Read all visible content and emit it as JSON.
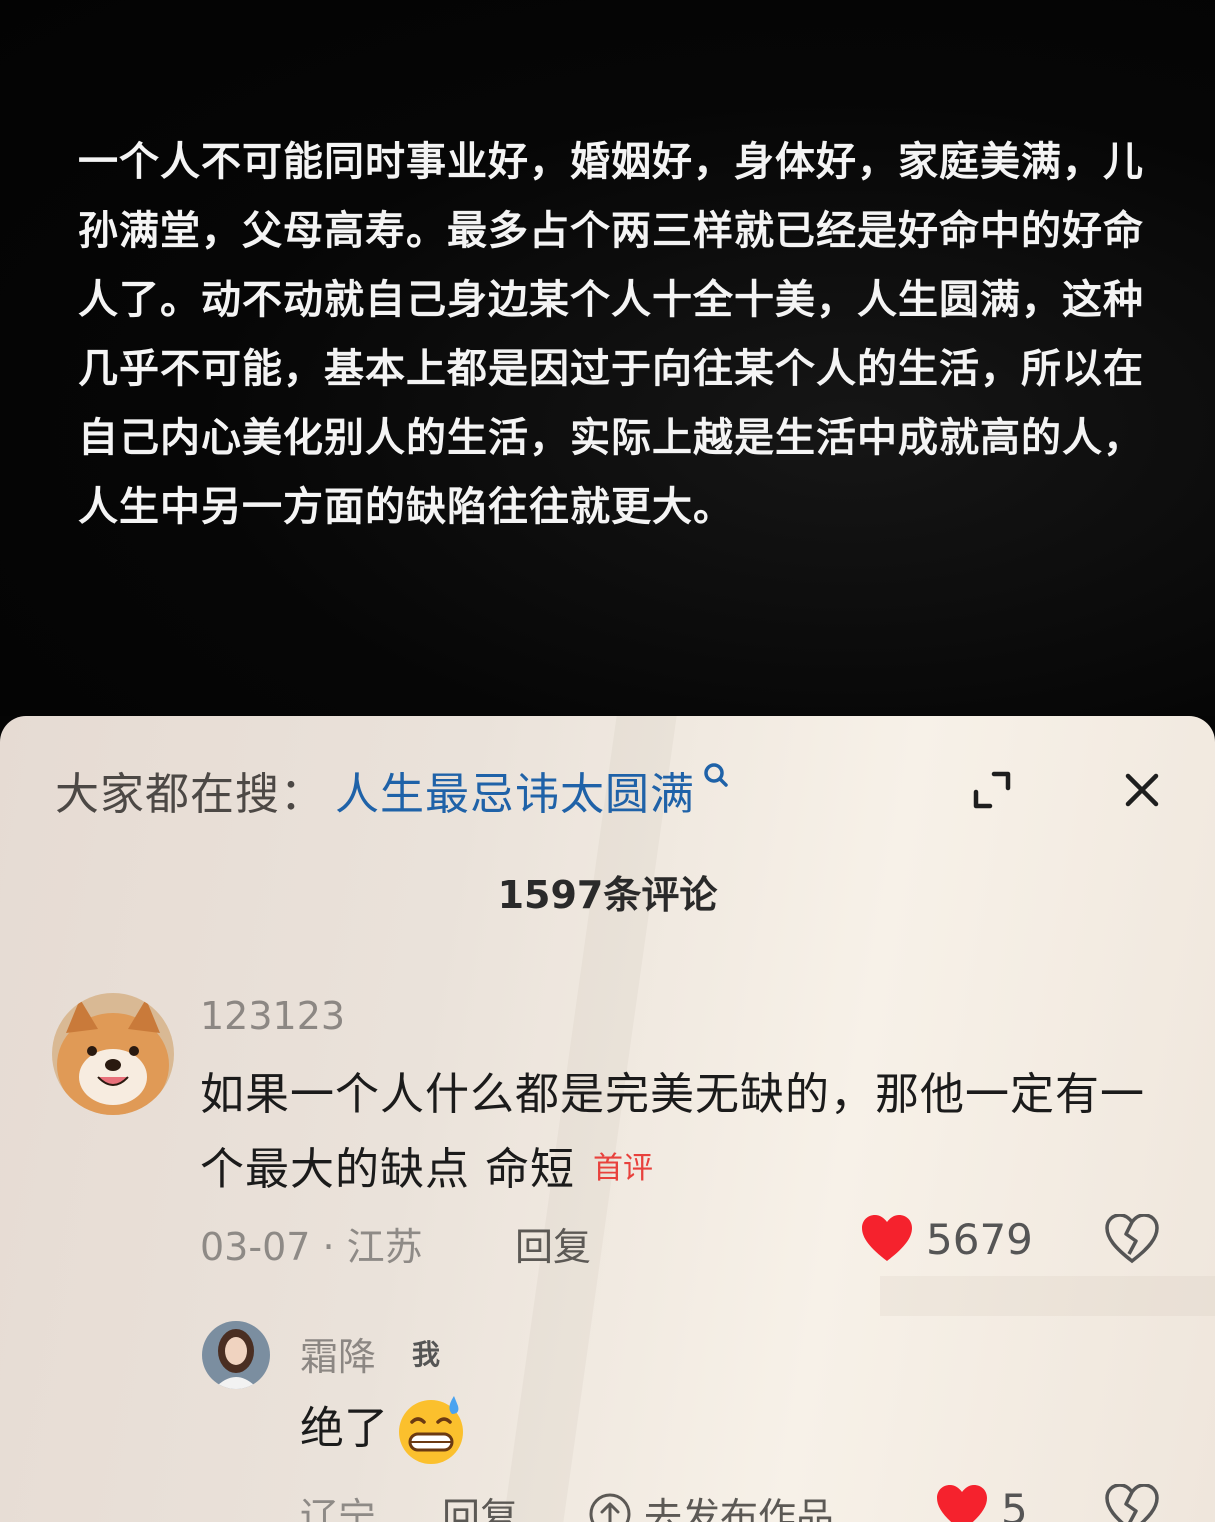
{
  "video": {
    "caption": "一个人不可能同时事业好，婚姻好，身体好，家庭美满，儿孙满堂，父母高寿。最多占个两三样就已经是好命中的好命人了。动不动就自己身边某个人十全十美，人生圆满，这种几乎不可能，基本上都是因过于向往某个人的生活，所以在自己内心美化别人的生活，实际上越是生活中成就高的人，人生中另一方面的缺陷往往就更大。"
  },
  "comments_panel": {
    "search_prefix": "大家都在搜：",
    "search_term": "人生最忌讳太圆满",
    "count_label": "1597条评论",
    "accent_color": "#1f62a8",
    "like_color": "#f5222d",
    "comments": [
      {
        "username": "123123",
        "text": "如果一个人什么都是完美无缺的，那他一定有一个最大的缺点 命短",
        "tag": "首评",
        "meta": "03-07 · 江苏",
        "reply_label": "回复",
        "likes": "5679",
        "avatar": "shiba-dog-avatar"
      },
      {
        "username": "霜降",
        "badge": "我",
        "text": "绝了",
        "emoji": "grinning-sweat-emoji",
        "meta": "辽宁",
        "reply_label": "回复",
        "publish_label": "去发布作品",
        "likes": "5",
        "avatar": "woman-portrait-avatar"
      }
    ]
  }
}
